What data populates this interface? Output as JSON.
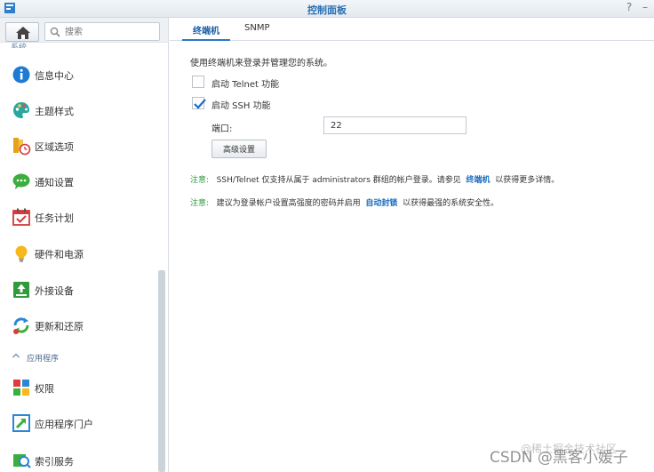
{
  "window": {
    "title": "控制面板",
    "help_glyph": "?",
    "minimize_glyph": "–"
  },
  "sidebar": {
    "search_placeholder": "搜索",
    "partial_category": "系统",
    "items": [
      {
        "label": "信息中心",
        "icon": "info-icon"
      },
      {
        "label": "主题样式",
        "icon": "palette-icon"
      },
      {
        "label": "区域选项",
        "icon": "region-clock-icon"
      },
      {
        "label": "通知设置",
        "icon": "chat-bubble-icon"
      },
      {
        "label": "任务计划",
        "icon": "calendar-check-icon"
      },
      {
        "label": "硬件和电源",
        "icon": "lightbulb-icon"
      },
      {
        "label": "外接设备",
        "icon": "external-device-icon"
      },
      {
        "label": "更新和还原",
        "icon": "update-restore-icon"
      },
      {
        "label": "权限",
        "icon": "privilege-grid-icon"
      },
      {
        "label": "应用程序门户",
        "icon": "app-portal-icon"
      },
      {
        "label": "索引服务",
        "icon": "index-service-icon"
      }
    ],
    "category_apps": "应用程序"
  },
  "tabs": [
    {
      "label": "终端机",
      "active": true
    },
    {
      "label": "SNMP",
      "active": false
    }
  ],
  "terminal": {
    "description": "使用终端机来登录并管理您的系统。",
    "telnet_label": "启动 Telnet 功能",
    "telnet_checked": false,
    "ssh_label": "启动 SSH 功能",
    "ssh_checked": true,
    "port_label": "端口:",
    "port_value": "22",
    "advanced_button": "高级设置"
  },
  "notes": {
    "note_label": "注意:",
    "note1_text_a": "SSH/Telnet 仅支持从属于 administrators 群组的帐户登录。请参见",
    "note1_link": "终端机",
    "note1_text_b": "以获得更多详情。",
    "note2_text_a": "建议为登录帐户设置高强度的密码并启用",
    "note2_link": "自动封锁",
    "note2_text_b": "以获得最强的系统安全性。"
  },
  "watermark": {
    "text": "CSDN @黑客小媛子",
    "text2": "@稀土掘金技术社区"
  },
  "colors": {
    "accent": "#2a78c8",
    "note_green": "#2e9a3c",
    "link_blue": "#1b6dc1"
  }
}
